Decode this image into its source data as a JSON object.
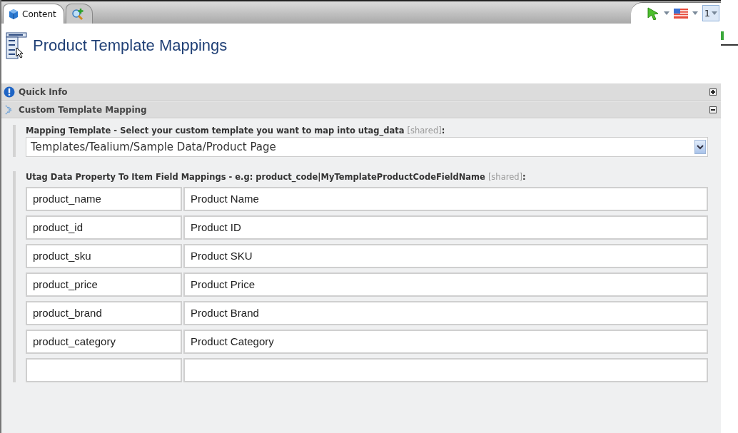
{
  "tabs": [
    {
      "kind": "content",
      "label": "Content",
      "selected": true
    },
    {
      "kind": "search-add",
      "selected": false
    }
  ],
  "toolbar": {
    "version_number": "1"
  },
  "page_title": "Product Template Mappings",
  "sections": [
    {
      "kind": "info",
      "title": "Quick Info",
      "expanded": false
    },
    {
      "kind": "mapping",
      "title": "Custom Template Mapping",
      "expanded": true
    }
  ],
  "mapping_template": {
    "label": "Mapping Template - Select your custom template you want to map into utag_data",
    "shared_note": "[shared]",
    "suffix": ":",
    "value": "Templates/Tealium/Sample Data/Product Page"
  },
  "field_mappings": {
    "label": "Utag Data Property To Item Field Mappings - e.g: product_code|MyTemplateProductCodeFieldName",
    "shared_note": "[shared]",
    "suffix": ":",
    "rows": [
      {
        "property": "product_name",
        "field": "Product Name"
      },
      {
        "property": "product_id",
        "field": "Product ID"
      },
      {
        "property": "product_sku",
        "field": "Product SKU"
      },
      {
        "property": "product_price",
        "field": "Product Price"
      },
      {
        "property": "product_brand",
        "field": "Product Brand"
      },
      {
        "property": "product_category",
        "field": "Product Category"
      },
      {
        "property": "",
        "field": ""
      }
    ]
  }
}
